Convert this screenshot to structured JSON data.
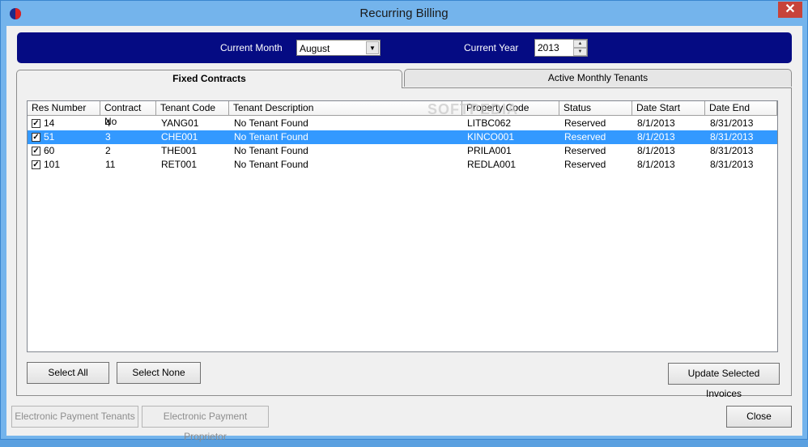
{
  "window": {
    "title": "Recurring Billing",
    "close_glyph": "✕"
  },
  "header": {
    "month_label": "Current Month",
    "month_value": "August",
    "year_label": "Current Year",
    "year_value": "2013"
  },
  "tabs": [
    {
      "label": "Fixed Contracts",
      "active": true
    },
    {
      "label": "Active Monthly Tenants",
      "active": false
    }
  ],
  "table": {
    "columns": [
      "Res Number",
      "Contract No",
      "Tenant Code",
      "Tenant Description",
      "Property Code",
      "Status",
      "Date Start",
      "Date End"
    ],
    "rows": [
      {
        "checked": true,
        "selected": false,
        "cells": [
          "14",
          "4",
          "YANG01",
          "No Tenant Found",
          "LITBC062",
          "Reserved",
          "8/1/2013",
          "8/31/2013"
        ]
      },
      {
        "checked": true,
        "selected": true,
        "cells": [
          "51",
          "3",
          "CHE001",
          "No Tenant Found",
          "KINCO001",
          "Reserved",
          "8/1/2013",
          "8/31/2013"
        ]
      },
      {
        "checked": true,
        "selected": false,
        "cells": [
          "60",
          "2",
          "THE001",
          "No Tenant Found",
          "PRILA001",
          "Reserved",
          "8/1/2013",
          "8/31/2013"
        ]
      },
      {
        "checked": true,
        "selected": false,
        "cells": [
          "101",
          "11",
          "RET001",
          "No Tenant Found",
          "REDLA001",
          "Reserved",
          "8/1/2013",
          "8/31/2013"
        ]
      }
    ]
  },
  "buttons": {
    "select_all": "Select All",
    "select_none": "Select None",
    "update_selected": "Update Selected Invoices",
    "electronic_payment_tenants": "Electronic Payment Tenants",
    "electronic_payment_proprietor": "Electronic Payment Proprietor",
    "close": "Close"
  },
  "watermark": "SOFTPEDIA",
  "colors": {
    "header_band": "#050b83",
    "selection": "#3399ff",
    "titlebar": "#74b4ec"
  }
}
